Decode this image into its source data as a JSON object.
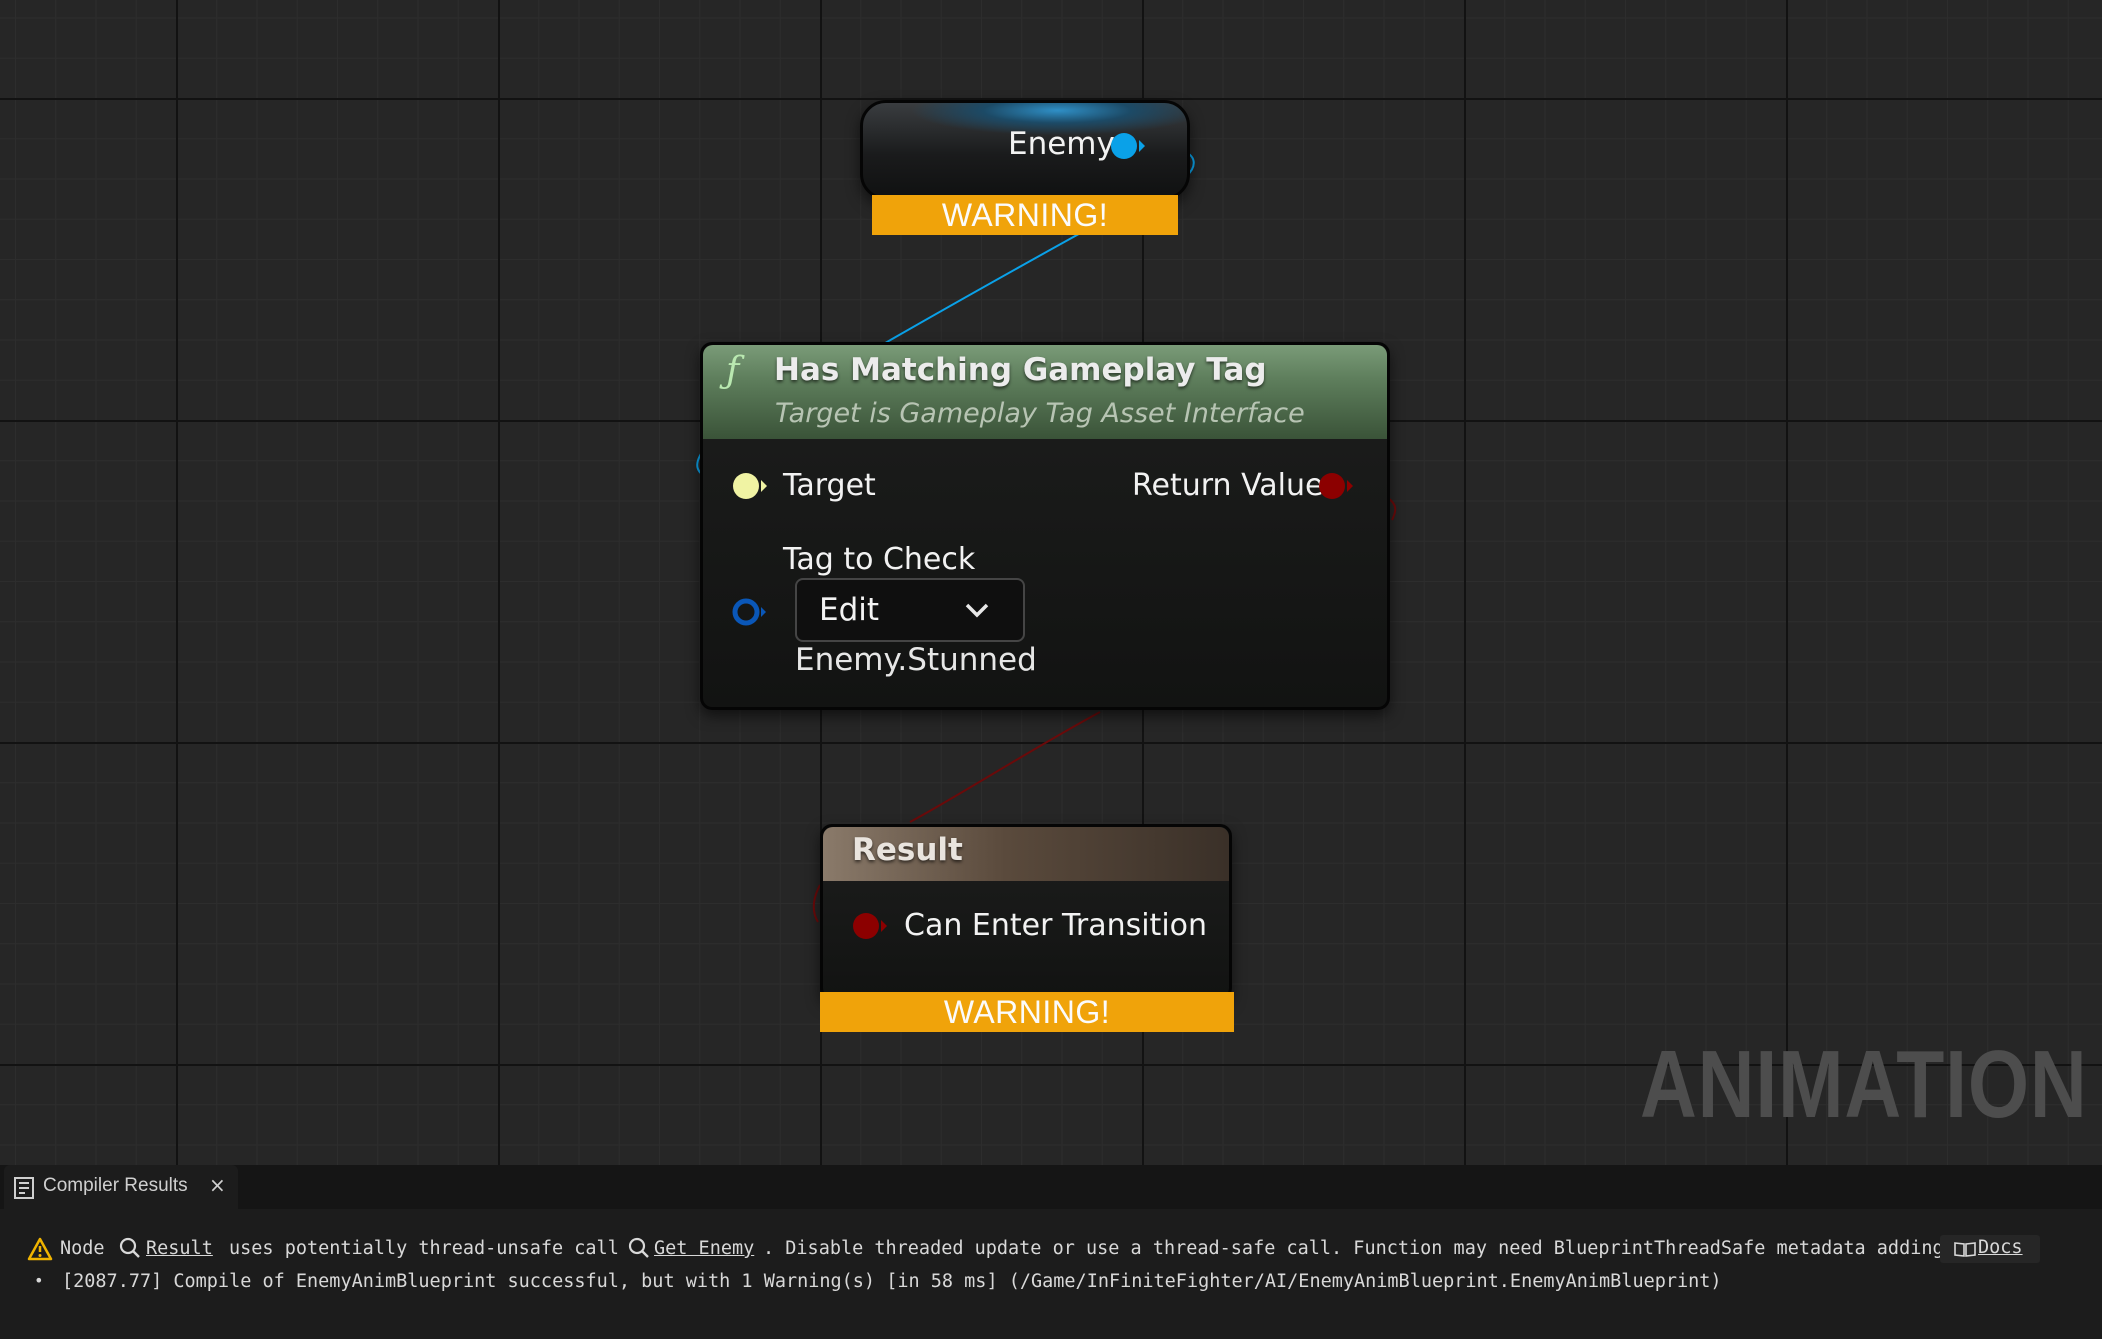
{
  "nodes": {
    "enemy": {
      "label": "Enemy",
      "warning": "WARNING!"
    },
    "func": {
      "icon": "function-icon",
      "icon_glyph": "ƒ",
      "title": "Has Matching Gameplay Tag",
      "subtitle": "Target is Gameplay Tag Asset Interface",
      "target_label": "Target",
      "return_label": "Return Value",
      "tag_label": "Tag to Check",
      "dropdown_value": "Edit",
      "tag_value": "Enemy.Stunned"
    },
    "result": {
      "title": "Result",
      "pin_label": "Can Enter Transition",
      "warning": "WARNING!"
    }
  },
  "watermark": "ANIMATION",
  "colors": {
    "object_pin": "#0aa1e8",
    "interface_pin": "#f0f3a3",
    "bool_pin": "#8c0000",
    "struct_pin": "#0a57b8",
    "warning": "#f0a30a",
    "func_header": "#5f7f5d"
  },
  "panel": {
    "tab_label": "Compiler Results",
    "tab_icon": "compiler-results-icon",
    "close_glyph": "×",
    "message": {
      "prefix": "Node",
      "node_link": "Result",
      "middle": "uses potentially thread-unsafe call",
      "call_link": "Get Enemy",
      "suffix": ". Disable threaded update or use a thread-safe call. Function may need BlueprintThreadSafe metadata adding.",
      "docs_label": "Docs"
    },
    "log_line": "[2087.77] Compile of EnemyAnimBlueprint successful, but with 1 Warning(s) [in 58 ms] (/Game/InFiniteFighter/AI/EnemyAnimBlueprint.EnemyAnimBlueprint)"
  }
}
